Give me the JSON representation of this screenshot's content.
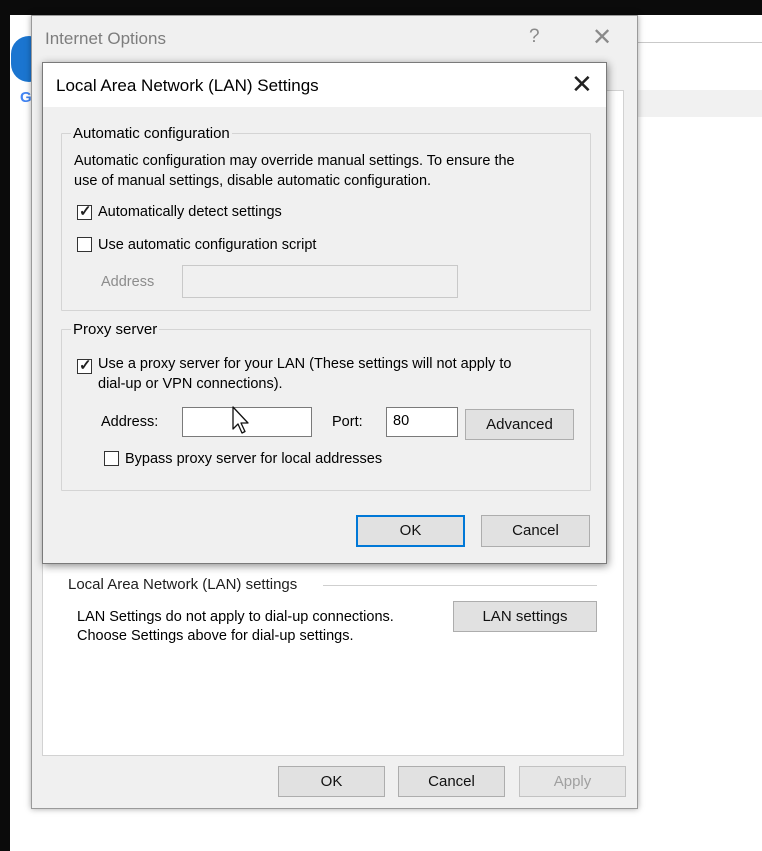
{
  "background": {
    "google_letter": "G"
  },
  "internet_options": {
    "title": "Internet Options",
    "help_glyph": "?",
    "close_glyph": "✕",
    "lan_group_label": "Local Area Network (LAN) settings",
    "lan_text_line1": "LAN Settings do not apply to dial-up connections.",
    "lan_text_line2": "Choose Settings above for dial-up settings.",
    "lan_settings_button": "LAN settings",
    "ok_button": "OK",
    "cancel_button": "Cancel",
    "apply_button": "Apply"
  },
  "lan_dialog": {
    "title": "Local Area Network (LAN) Settings",
    "close_glyph": "✕",
    "auto_config": {
      "label": "Automatic configuration",
      "description_line1": "Automatic configuration may override manual settings.  To ensure the",
      "description_line2": "use of manual settings, disable automatic configuration.",
      "detect_settings_label": "Automatically detect settings",
      "detect_settings_checked": true,
      "use_script_label": "Use automatic configuration script",
      "use_script_checked": false,
      "address_label": "Address",
      "address_value": ""
    },
    "proxy_server": {
      "label": "Proxy server",
      "use_proxy_line1": "Use a proxy server for your LAN (These settings will not apply to",
      "use_proxy_line2": "dial-up or VPN connections).",
      "use_proxy_checked": true,
      "address_label": "Address:",
      "address_value": "",
      "port_label": "Port:",
      "port_value": "80",
      "advanced_button": "Advanced",
      "bypass_label": "Bypass proxy server for local addresses",
      "bypass_checked": false
    },
    "ok_button": "OK",
    "cancel_button": "Cancel"
  },
  "colors": {
    "accent": "#0078d7",
    "dialog_bg": "#f0f0f0"
  }
}
